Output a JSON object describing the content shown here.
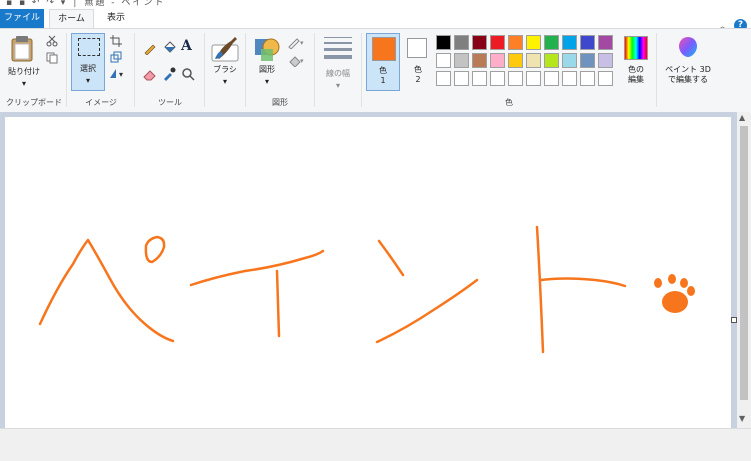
{
  "quick_access": "▪ ▪ ↶ ↷ ▾ │ 無題 - ペイント",
  "tabs": {
    "file": "ファイル",
    "home": "ホーム",
    "view": "表示"
  },
  "ribbon": {
    "clipboard": {
      "paste": "貼り付け",
      "group": "クリップボード"
    },
    "image": {
      "select": "選択",
      "group": "イメージ"
    },
    "tools": {
      "group": "ツール",
      "text_glyph": "A"
    },
    "brushes": {
      "label": "ブラシ"
    },
    "shapes": {
      "label": "図形",
      "group": "図形"
    },
    "size": {
      "label": "線の幅"
    },
    "colors": {
      "color1_label": "色",
      "color1_num": "1",
      "color2_label": "色",
      "color2_num": "2",
      "edit_colors_l1": "色の",
      "edit_colors_l2": "編集",
      "group": "色",
      "color1": "#f7761d",
      "color2": "#ffffff",
      "palette_row1": [
        "#000000",
        "#7f7f7f",
        "#880015",
        "#ed1c24",
        "#ff7f27",
        "#fff200",
        "#22b14c",
        "#00a2e8",
        "#3f48cc",
        "#a349a4"
      ],
      "palette_row2": [
        "#ffffff",
        "#c3c3c3",
        "#b97a57",
        "#ffaec9",
        "#ffc90e",
        "#efe4b0",
        "#b5e61d",
        "#99d9ea",
        "#7092be",
        "#c8bfe7"
      ],
      "palette_row3": [
        "#ffffff",
        "#ffffff",
        "#ffffff",
        "#ffffff",
        "#ffffff",
        "#ffffff",
        "#ffffff",
        "#ffffff",
        "#ffffff",
        "#ffffff"
      ]
    },
    "paint3d": {
      "line1": "ペイント 3D",
      "line2": "で編集する"
    }
  },
  "canvas": {
    "stroke_color": "#f7761d",
    "background": "#ffffff"
  }
}
